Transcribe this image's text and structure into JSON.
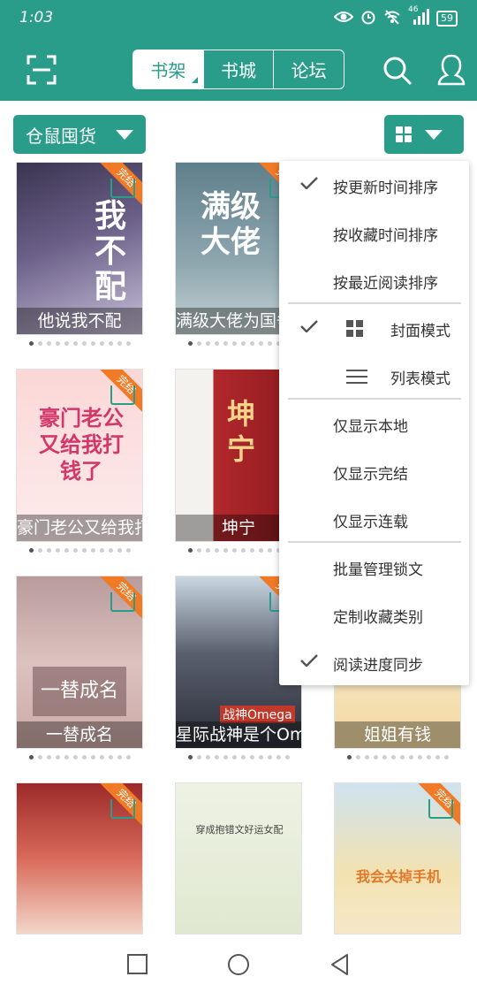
{
  "status_bar": {
    "time": "1:03",
    "signal_label": "46",
    "battery": "59"
  },
  "header": {
    "tabs": [
      {
        "label": "书架",
        "active": true
      },
      {
        "label": "书城",
        "active": false
      },
      {
        "label": "论坛",
        "active": false
      }
    ],
    "accent_color": "#2a9d8a"
  },
  "toolbar": {
    "category_label": "仓鼠囤货"
  },
  "books": [
    {
      "title": "他说我不配",
      "cover_text": "我不配",
      "badge": "完结"
    },
    {
      "title": "满级大佬为国争光",
      "cover_text": "满级大佬",
      "badge": "完结"
    },
    {
      "title": "豪门老公又给我打钱了",
      "cover_text": "豪门老公又给我打钱了",
      "badge": "完结"
    },
    {
      "title": "坤宁",
      "cover_text": "坤宁",
      "badge": ""
    },
    {
      "title": "一替成名",
      "cover_text": "一替成名",
      "badge": "完结"
    },
    {
      "title": "星际战神是个Omega",
      "cover_text": "战神Omega",
      "badge": "完结"
    },
    {
      "title": "姐姐有钱",
      "cover_text": "",
      "badge": ""
    },
    {
      "title": "",
      "cover_text": "",
      "badge": "完结"
    },
    {
      "title": "",
      "cover_text": "穿成抱错文好运女配",
      "badge": ""
    },
    {
      "title": "",
      "cover_text": "我会关掉手机",
      "badge": "完结"
    }
  ],
  "menu": {
    "items": [
      {
        "label": "按更新时间排序",
        "checked": true
      },
      {
        "label": "按收藏时间排序",
        "checked": false
      },
      {
        "label": "按最近阅读排序",
        "checked": false
      },
      {
        "label": "封面模式",
        "checked": true
      },
      {
        "label": "列表模式",
        "checked": false
      },
      {
        "label": "仅显示本地",
        "checked": false
      },
      {
        "label": "仅显示完结",
        "checked": false
      },
      {
        "label": "仅显示连载",
        "checked": false
      },
      {
        "label": "批量管理锁文",
        "checked": false
      },
      {
        "label": "定制收藏类别",
        "checked": false
      },
      {
        "label": "阅读进度同步",
        "checked": true
      }
    ]
  }
}
